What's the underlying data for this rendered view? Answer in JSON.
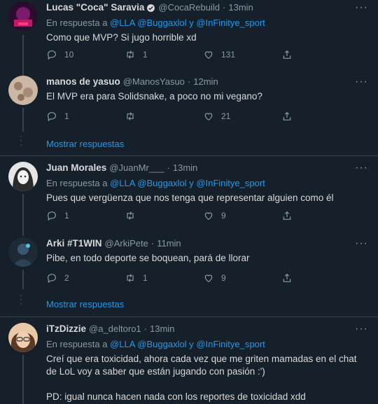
{
  "tweets": [
    {
      "name": "Lucas \"Coca\" Saravia",
      "handle": "@CocaRebuild",
      "time": "13min",
      "reply_prefix": "En respuesta a",
      "reply_mentions": "@LLA @Buggaxlol y @InFinitye_sport",
      "text": "Como que MVP? Si jugo horrible xd",
      "replies": "10",
      "retweets": "1",
      "likes": "131"
    },
    {
      "name": "manos de yasuo",
      "handle": "@ManosYasuo",
      "time": "12min",
      "text": "El MVP era para Solidsnake, a poco no mi vegano?",
      "replies": "1",
      "retweets": "",
      "likes": "21"
    },
    {
      "name": "Juan Morales",
      "handle": "@JuanMr___",
      "time": "13min",
      "reply_prefix": "En respuesta a",
      "reply_mentions": "@LLA @Buggaxlol y @InFinitye_sport",
      "text": "Pues que vergüenza que nos tenga que representar alguien como él",
      "replies": "1",
      "retweets": "",
      "likes": "9"
    },
    {
      "name": "Arki #T1WIN",
      "handle": "@ArkiPete",
      "time": "11min",
      "text": "Pibe, en todo deporte se boquean, pará de llorar",
      "replies": "2",
      "retweets": "1",
      "likes": "9"
    },
    {
      "name": "iTzDizzie",
      "handle": "@a_deltoro1",
      "time": "13min",
      "reply_prefix": "En respuesta a",
      "reply_mentions": "@LLA @Buggaxlol y @InFinitye_sport",
      "text_line1": "Creí que era toxicidad, ahora cada vez que me griten mamadas en el chat",
      "text_line2": "de LoL voy a saber que están jugando con pasión :')",
      "text_line3": "PD: igual nunca hacen nada con los reportes de toxicidad xdd"
    }
  ],
  "show_replies_label": "Mostrar respuestas",
  "separator": "·",
  "more": "···",
  "colors": {
    "background": "#15202b",
    "link": "#1d9bf0",
    "secondary": "#8b98a5",
    "text": "#d9d9d9",
    "border": "#38444d"
  },
  "icons": [
    "reply-icon",
    "retweet-icon",
    "like-icon",
    "share-icon",
    "verified-icon",
    "more-icon"
  ]
}
